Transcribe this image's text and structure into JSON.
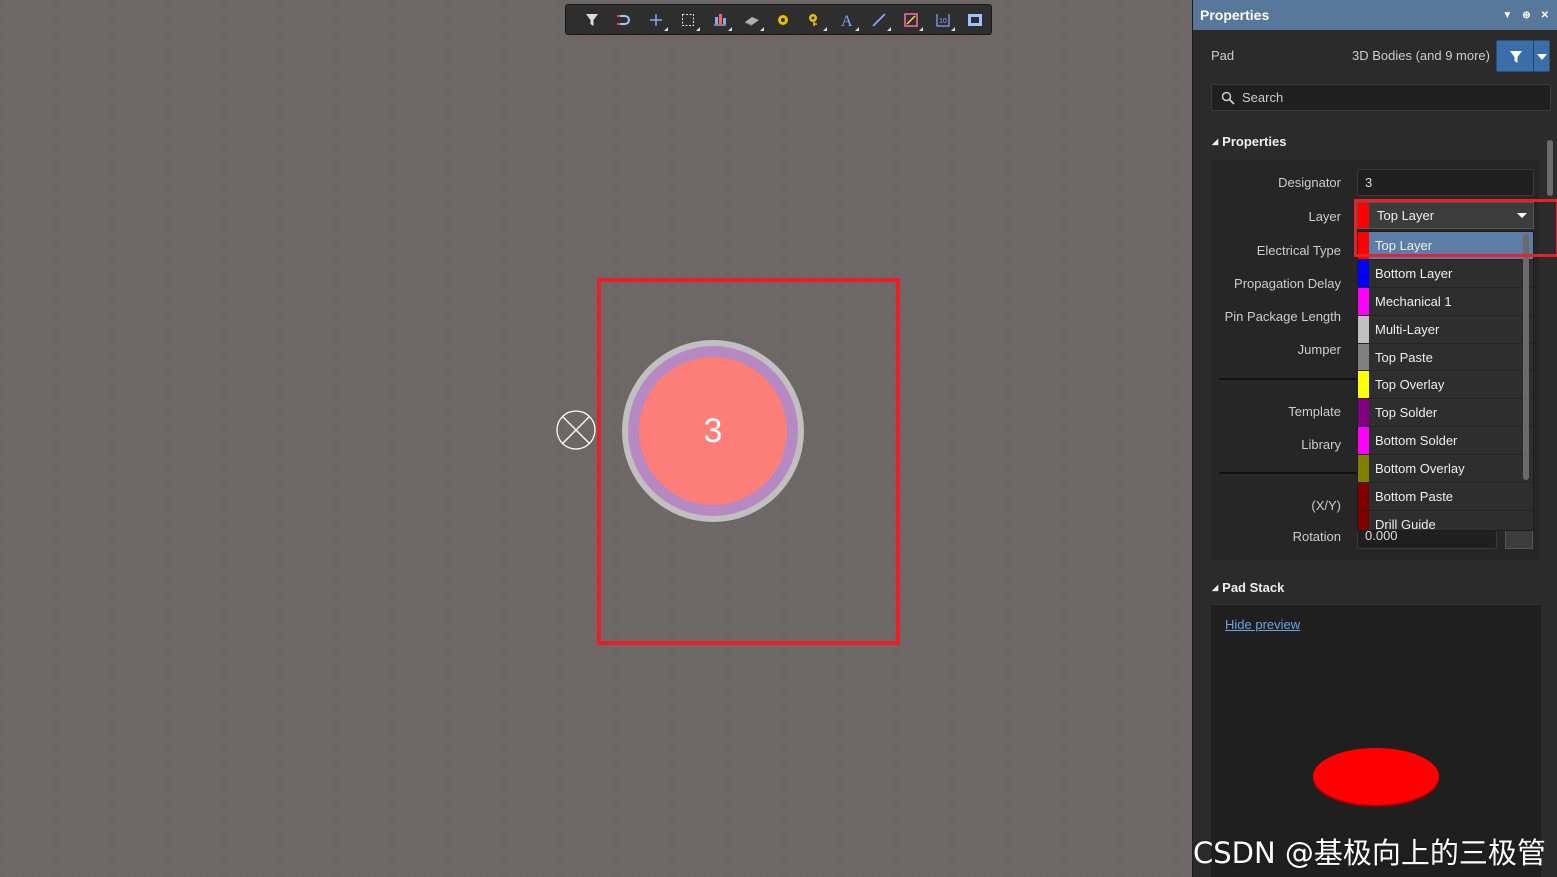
{
  "canvas": {
    "pad_designator": "3"
  },
  "toolbar": {
    "buttons": [
      {
        "icon": "filter-icon",
        "dropdown": false
      },
      {
        "icon": "route-icon",
        "dropdown": false
      },
      {
        "icon": "cross-icon",
        "dropdown": true
      },
      {
        "icon": "select-rect-icon",
        "dropdown": true
      },
      {
        "icon": "align-icon",
        "dropdown": true
      },
      {
        "icon": "component-icon",
        "dropdown": true
      },
      {
        "icon": "pad-icon",
        "dropdown": false
      },
      {
        "icon": "via-icon",
        "dropdown": true
      },
      {
        "icon": "text-icon",
        "dropdown": true
      },
      {
        "icon": "line-icon",
        "dropdown": true
      },
      {
        "icon": "region-icon",
        "dropdown": true
      },
      {
        "icon": "dimension-icon",
        "dropdown": true
      },
      {
        "icon": "view-icon",
        "dropdown": false
      }
    ]
  },
  "panel": {
    "title": "Properties",
    "object_type": "Pad",
    "object_filter": "3D Bodies (and 9 more)",
    "search_placeholder": "Search",
    "section_properties": "Properties",
    "labels": {
      "designator": "Designator",
      "layer": "Layer",
      "electrical_type": "Electrical Type",
      "propagation_delay": "Propagation Delay",
      "pin_package_length": "Pin Package Length",
      "jumper": "Jumper",
      "template": "Template",
      "library": "Library",
      "xy": "(X/Y)",
      "rotation": "Rotation"
    },
    "values": {
      "designator": "3",
      "layer": "Top Layer",
      "rotation": "0.000"
    },
    "layer_color": "#ff0000",
    "layer_options": [
      {
        "label": "Top Layer",
        "color": "#ff0000",
        "selected": true
      },
      {
        "label": "Bottom Layer",
        "color": "#0000ff",
        "selected": false
      },
      {
        "label": "Mechanical 1",
        "color": "#ff00ff",
        "selected": false
      },
      {
        "label": "Multi-Layer",
        "color": "#c0c0c0",
        "selected": false
      },
      {
        "label": "Top Paste",
        "color": "#808080",
        "selected": false
      },
      {
        "label": "Top Overlay",
        "color": "#ffff00",
        "selected": false
      },
      {
        "label": "Top Solder",
        "color": "#800080",
        "selected": false
      },
      {
        "label": "Bottom Solder",
        "color": "#ff00ff",
        "selected": false
      },
      {
        "label": "Bottom Overlay",
        "color": "#808000",
        "selected": false
      },
      {
        "label": "Bottom Paste",
        "color": "#800000",
        "selected": false
      },
      {
        "label": "Drill Guide",
        "color": "#800000",
        "selected": false
      }
    ],
    "section_pad_stack": "Pad Stack",
    "hide_preview": "Hide preview"
  },
  "watermark": "CSDN @基极向上的三极管",
  "colors": {
    "selection_red": "#e8202a",
    "pad_copper": "#fd7d79",
    "panel_title_bg": "#57779b"
  }
}
